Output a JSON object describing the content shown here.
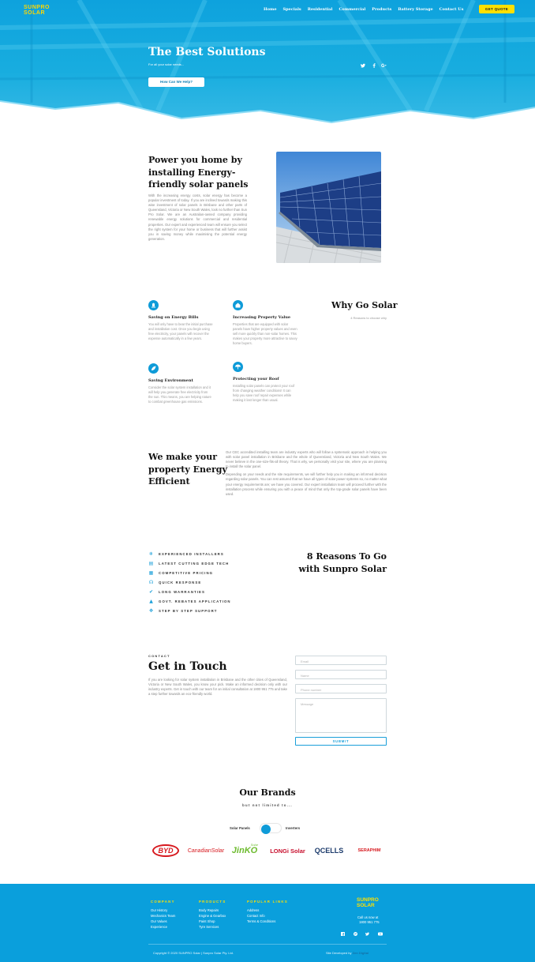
{
  "header": {
    "logo_top": "SUNPRO",
    "logo_bottom": "SOLAR",
    "nav": [
      "Home",
      "Specials",
      "Residential",
      "Commercial",
      "Products",
      "Battery Storage",
      "Contact Us"
    ],
    "cta": "GET QUOTE"
  },
  "hero": {
    "title": "The Best Solutions",
    "subtitle": "For all your solar needs...",
    "button": "How Can We Help?",
    "social": [
      "twitter-icon",
      "facebook-icon",
      "google-plus-icon"
    ]
  },
  "power": {
    "title": "Power you home by installing Energy-friendly solar panels",
    "text": "With the increasing energy costs, solar energy has become a popular investment of today. If you are inclined towards making this wise investment of solar panels in Brisbane and other parts of Queensland, Victoria or New South Wales, look no further than Sun Pro Solar. We are an Australian-owned company providing renewable energy solutions for commercial and residential properties. Our expert and experienced team will ensure you select the right system for your home or business that will further assist you in saving money while maximising the potential energy generation."
  },
  "why": {
    "title": "Why Go Solar",
    "subtitle": "4 Reasons to choose why",
    "features": [
      {
        "title": "Saving on Energy Bills",
        "text": "You will only have to bear the initial purchase and installation cost. Once you begin using free electricity, your panels will recover the expense automatically in a few years.",
        "icon": "savings-icon"
      },
      {
        "title": "Increasing Property Value",
        "text": "Properties that are equipped with solar panels have higher property values and even sell more quickly than non-solar homes. This makes your property more attractive to savvy home buyers.",
        "icon": "home-icon"
      },
      {
        "title": "Saving Environment",
        "text": "Consider the solar system installation and it will help you generate free electricity from the sun. This means, you are helping nature to combat greenhouse gas emissions.",
        "icon": "leaf-icon"
      },
      {
        "title": "Protecting your Roof",
        "text": "Installing solar panels can protect your roof from changing weather conditions! It can help you save roof repair expenses while making it last longer than usual.",
        "icon": "umbrella-icon"
      }
    ]
  },
  "efficient": {
    "title": "We make your property Energy Efficient",
    "p1": "Our CEC accredited installing team are industry experts who will follow a systematic approach in helping you with solar panel installation in Brisbane and the whole of Queensland, Victoria and New South Wales. We never believe in the one-size-fits-all theory. That is why, we personally visit your site, where you are planning to install the solar panel.",
    "p2": "Depending on your needs and the site requirements, we will further help you in making an informed decision regarding solar panels. You can rest assured that we have all types of solar power systems so, no matter what your energy requirements are; we have you covered. Our expert installation team will proceed further with the installation process while ensuring you with a peace of mind that only the top-grade solar panels have been used."
  },
  "reasons": {
    "title": "8 Reasons To Go with Sunpro Solar",
    "items": [
      {
        "label": "EXPERIENCED INSTALLERS",
        "icon": "snowflake-icon"
      },
      {
        "label": "LATEST CUTTING EDGE TECH",
        "icon": "solar-panel-icon"
      },
      {
        "label": "COMPETITIVE PRICING",
        "icon": "price-icon"
      },
      {
        "label": "QUICK RESPONSE",
        "icon": "headset-icon"
      },
      {
        "label": "LONG WARRANTIES",
        "icon": "shield-check-icon"
      },
      {
        "label": "GOVT. REBATES APPLICATION",
        "icon": "government-icon"
      },
      {
        "label": "STEP BY STEP SUPPORT",
        "icon": "support-icon"
      }
    ]
  },
  "contact": {
    "label": "CONTACT",
    "title": "Get in Touch",
    "text": "If you are looking for solar system installation in Brisbane and the other cities of Queensland, Victoria or New South Wales, you know your pick. Make an informed decision only with our industry experts. Get in touch with our team for an initial consultation at 1800 951 775 and take a step further towards an eco-friendly world.",
    "fields": {
      "email": "Email",
      "name": "Name",
      "phone": "Phone number",
      "message": "Message"
    },
    "submit": "SUBMIT"
  },
  "brands": {
    "title": "Our Brands",
    "subtitle": "but not limited to...",
    "toggle_left": "Solar Panels",
    "toggle_right": "Inverters",
    "logos": [
      "BYD",
      "CanadianSolar",
      "JinKO",
      "LONGi Solar",
      "QCELLS",
      "SERAPHIM"
    ],
    "jinko_super": "Solar"
  },
  "footer": {
    "company": {
      "heading": "COMPANY",
      "items": [
        "Our History",
        "Mechanics Team",
        "Our Values",
        "Experience"
      ]
    },
    "products": {
      "heading": "PRODUCTS",
      "items": [
        "Body Repairs",
        "Engine & Gearbox",
        "Paint Shop",
        "Tyre Services"
      ]
    },
    "popular": {
      "heading": "POPULAR LINKS",
      "items": [
        "Address",
        "Contact Info",
        "Terms & Conditions"
      ]
    },
    "logo_top": "SUNPRO",
    "logo_bottom": "SOLAR",
    "call_label": "Call us now at",
    "phone": "1800 951 775",
    "copyright": "Copyright © 2020 SUNPRO Solar | Sunpro Solar Pty. Ltd.",
    "dev_label": "Site Developed by",
    "dev_name": "Zen Digital",
    "social": [
      "facebook-icon",
      "pinterest-icon",
      "twitter-icon",
      "youtube-icon"
    ]
  },
  "colors": {
    "brand_blue": "#0a9fdc",
    "accent_yellow": "#ffe000"
  }
}
